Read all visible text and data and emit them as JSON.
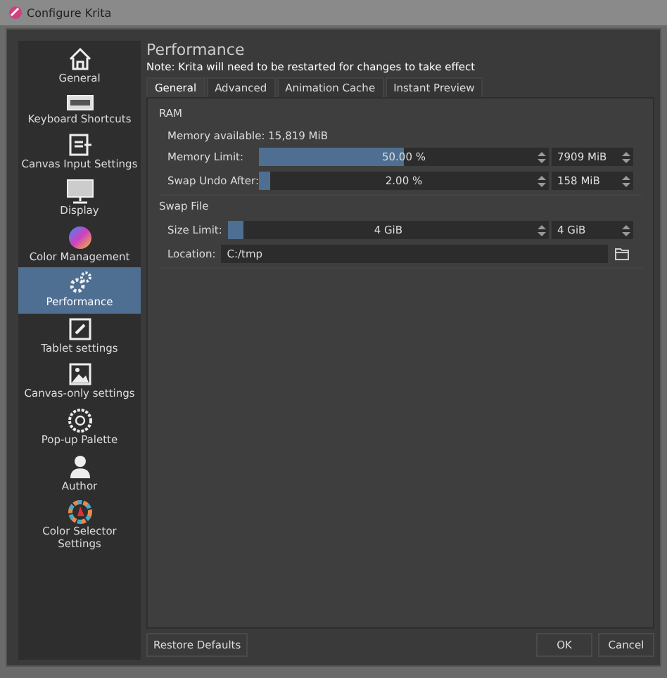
{
  "window": {
    "title": "Configure Krita"
  },
  "sidebar": {
    "items": [
      {
        "label": "General",
        "selected": false
      },
      {
        "label": "Keyboard Shortcuts",
        "selected": false
      },
      {
        "label": "Canvas Input Settings",
        "selected": false
      },
      {
        "label": "Display",
        "selected": false
      },
      {
        "label": "Color Management",
        "selected": false
      },
      {
        "label": "Performance",
        "selected": true
      },
      {
        "label": "Tablet settings",
        "selected": false
      },
      {
        "label": "Canvas-only settings",
        "selected": false
      },
      {
        "label": "Pop-up Palette",
        "selected": false
      },
      {
        "label": "Author",
        "selected": false
      },
      {
        "label": "Color Selector Settings",
        "selected": false
      }
    ]
  },
  "page": {
    "title": "Performance",
    "note": "Note: Krita will need to be restarted for changes to take effect"
  },
  "tabs": [
    {
      "label": "General",
      "selected": true
    },
    {
      "label": "Advanced",
      "selected": false
    },
    {
      "label": "Animation Cache",
      "selected": false
    },
    {
      "label": "Instant Preview",
      "selected": false
    }
  ],
  "ram": {
    "title": "RAM",
    "available": "Memory available: 15,819 MiB",
    "rows": [
      {
        "label": "Memory Limit:",
        "level": 0.5,
        "reading": "50.00 %",
        "value": "7909 MiB"
      },
      {
        "label": "Swap Undo After:",
        "level": 0.04,
        "reading": "2.00 %",
        "value": "158 MiB"
      }
    ]
  },
  "swap": {
    "title": "Swap File",
    "size": {
      "label": "Size Limit:",
      "level": 0.05,
      "reading": "4 GiB",
      "value": "4 GiB"
    },
    "location": {
      "label": "Location:",
      "value": "C:/tmp"
    }
  },
  "buttons": {
    "restore": "Restore Defaults",
    "ok": "OK",
    "cancel": "Cancel"
  }
}
